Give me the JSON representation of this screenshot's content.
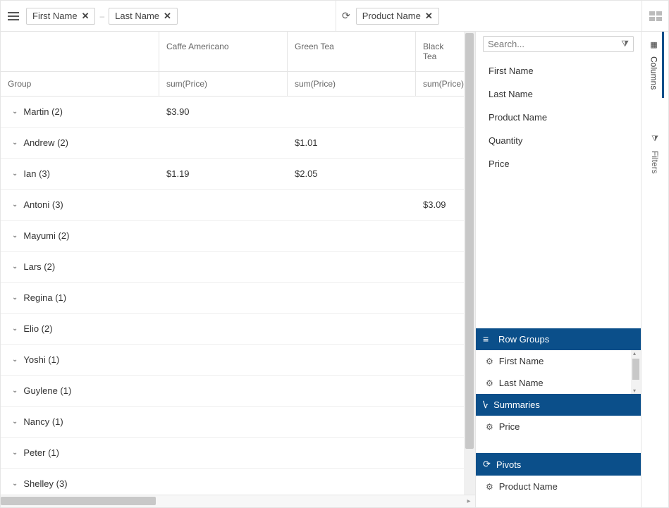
{
  "topbar": {
    "group_chips": [
      {
        "label": "First Name"
      },
      {
        "label": "Last Name"
      }
    ],
    "pivot_chips": [
      {
        "label": "Product Name"
      }
    ]
  },
  "grid": {
    "group_header": "Group",
    "columns": [
      {
        "title": "Caffe Americano",
        "agg": "sum(Price)"
      },
      {
        "title": "Green Tea",
        "agg": "sum(Price)"
      },
      {
        "title": "Black Tea",
        "agg": "sum(Price)"
      }
    ],
    "rows": [
      {
        "label": "Martin (2)",
        "c0": "$3.90",
        "c1": "",
        "c2": ""
      },
      {
        "label": "Andrew (2)",
        "c0": "",
        "c1": "$1.01",
        "c2": ""
      },
      {
        "label": "Ian (3)",
        "c0": "$1.19",
        "c1": "$2.05",
        "c2": ""
      },
      {
        "label": "Antoni (3)",
        "c0": "",
        "c1": "",
        "c2": "$3.09"
      },
      {
        "label": "Mayumi (2)",
        "c0": "",
        "c1": "",
        "c2": ""
      },
      {
        "label": "Lars (2)",
        "c0": "",
        "c1": "",
        "c2": ""
      },
      {
        "label": "Regina (1)",
        "c0": "",
        "c1": "",
        "c2": ""
      },
      {
        "label": "Elio (2)",
        "c0": "",
        "c1": "",
        "c2": ""
      },
      {
        "label": "Yoshi (1)",
        "c0": "",
        "c1": "",
        "c2": ""
      },
      {
        "label": "Guylene (1)",
        "c0": "",
        "c1": "",
        "c2": ""
      },
      {
        "label": "Nancy (1)",
        "c0": "",
        "c1": "",
        "c2": ""
      },
      {
        "label": "Peter (1)",
        "c0": "",
        "c1": "",
        "c2": ""
      },
      {
        "label": "Shelley (3)",
        "c0": "",
        "c1": "",
        "c2": ""
      }
    ]
  },
  "sidepanel": {
    "search_placeholder": "Search...",
    "columns": [
      "First Name",
      "Last Name",
      "Product Name",
      "Quantity",
      "Price"
    ],
    "row_groups": {
      "title": "Row Groups",
      "items": [
        "First Name",
        "Last Name"
      ]
    },
    "summaries": {
      "title": "Summaries",
      "items": [
        "Price"
      ]
    },
    "pivots": {
      "title": "Pivots",
      "items": [
        "Product Name"
      ]
    }
  },
  "rail": {
    "columns_label": "Columns",
    "filters_label": "Filters"
  }
}
